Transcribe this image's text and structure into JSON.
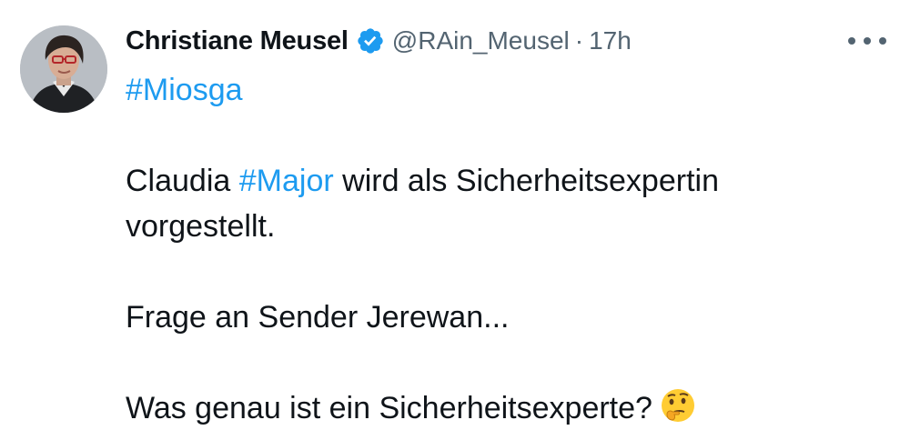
{
  "author": {
    "name": "Christiane Meusel",
    "handle": "@RAin_Meusel",
    "separator": "·",
    "time": "17h",
    "avatar_icon": "profile-photo",
    "verified_icon": "verified-badge-icon"
  },
  "colors": {
    "link": "#1d9bf0",
    "text": "#0f1419",
    "secondary": "#536471"
  },
  "tweet": {
    "hashtag_top": "#Miosga",
    "line1_start": "Claudia ",
    "line1_hashtag": "#Major",
    "line1_end": " wird als Sicherheitsexpertin",
    "line2": "vorgestellt.",
    "line3": "Frage an Sender Jerewan...",
    "line4": "Was genau ist ein Sicherheitsexperte?",
    "emoji_icon": "thinking-face-emoji"
  }
}
